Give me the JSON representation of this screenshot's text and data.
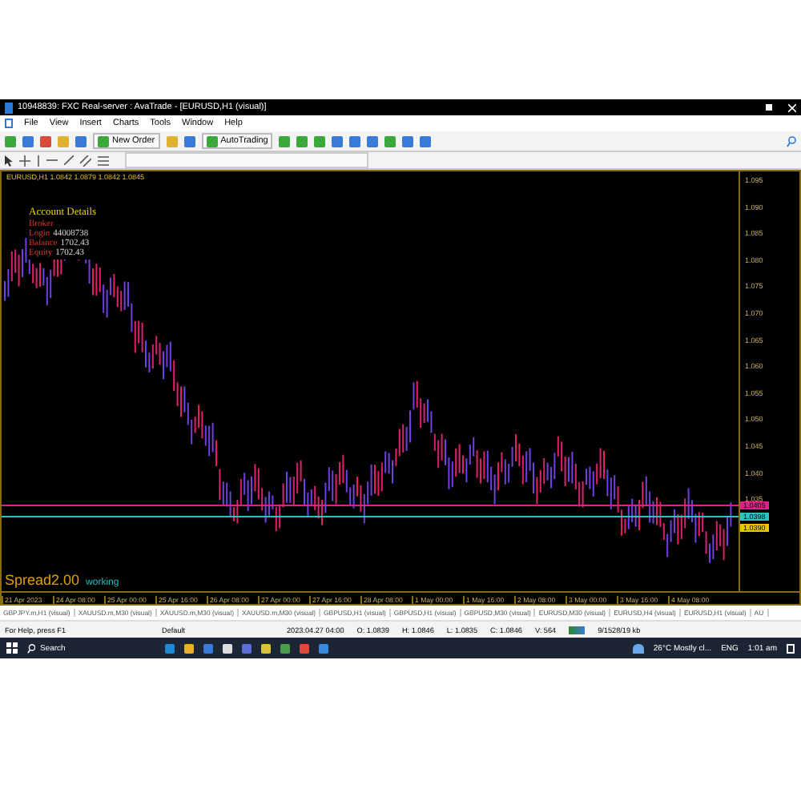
{
  "window": {
    "title": "10948839: FXC Real-server : AvaTrade - [EURUSD,H1 (visual)]"
  },
  "menu": [
    "File",
    "View",
    "Insert",
    "Charts",
    "Tools",
    "Window",
    "Help"
  ],
  "toolbar": {
    "new_order": "New Order",
    "auto_trading": "AutoTrading"
  },
  "chart": {
    "symbol_line": "EURUSD,H1  1.0842 1.0879 1.0842 1.0845",
    "account": {
      "title": "Account Details",
      "rows": [
        {
          "label": "Broker",
          "value": ""
        },
        {
          "label": "Login",
          "value": "44008738"
        },
        {
          "label": "Balance",
          "value": "1702.43"
        },
        {
          "label": "Equity",
          "value": "1702.43"
        }
      ]
    },
    "spread": "Spread2.00",
    "status": "working",
    "price_labels": [
      "1.095",
      "1.090",
      "1.085",
      "1.080",
      "1.075",
      "1.070",
      "1.065",
      "1.060",
      "1.055",
      "1.050",
      "1.045",
      "1.040",
      "1.035"
    ],
    "price_tags": [
      {
        "text": "1.0405",
        "color": "#e0208a"
      },
      {
        "text": "1.0398",
        "color": "#29c4c4"
      },
      {
        "text": "1.0390",
        "color": "#e8c800"
      }
    ],
    "time_labels": [
      "21 Apr 2023",
      "24 Apr 08:00",
      "25 Apr 00:00",
      "25 Apr 16:00",
      "26 Apr 08:00",
      "27 Apr 00:00",
      "27 Apr 16:00",
      "28 Apr 08:00",
      "1 May 00:00",
      "1 May 16:00",
      "2 May 08:00",
      "3 May 00:00",
      "3 May 16:00",
      "4 May 08:00"
    ]
  },
  "tabs": [
    "GBPJPY.m,H1 (visual)",
    "XAUUSD.m,M30 (visual)",
    "XAUUSD.m,M30 (visual)",
    "XAUUSD.m,M30 (visual)",
    "GBPUSD,H1 (visual)",
    "GBPUSD,H1 (visual)",
    "GBPUSD,M30 (visual)",
    "EURUSD,M30 (visual)",
    "EURUSD,H4 (visual)",
    "EURUSD,H1 (visual)",
    "AU"
  ],
  "status_bar": {
    "help": "For Help, press F1",
    "profile": "Default",
    "time": "2023.04.27 04:00",
    "open": "O: 1.0839",
    "high": "H: 1.0846",
    "low": "L: 1.0835",
    "close": "C: 1.0846",
    "volume": "V: 564",
    "traffic": "9/1528/19 kb"
  },
  "taskbar": {
    "search": "Search",
    "weather": "26°C  Mostly cl...",
    "language": "ENG",
    "clock": "1:01 am"
  }
}
